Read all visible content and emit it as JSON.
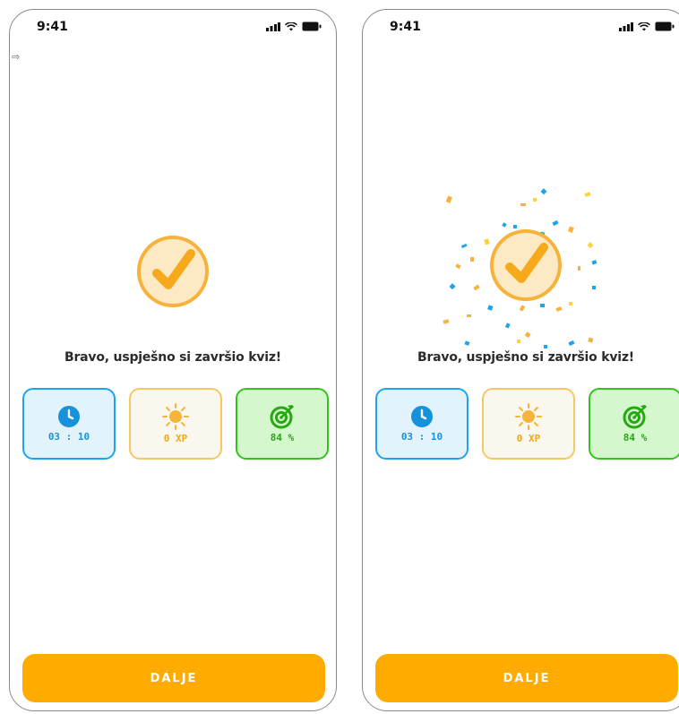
{
  "screens": [
    {
      "id": "before-confetti",
      "status_time": "9:41",
      "message": "Bravo, uspješno si završio kviz!",
      "stats": {
        "time": {
          "icon": "clock-icon",
          "value": "03 : 10"
        },
        "xp": {
          "icon": "sun-icon",
          "value": "0 XP"
        },
        "accuracy": {
          "icon": "target-icon",
          "value": "84 %"
        }
      },
      "button_label": "DALJE"
    },
    {
      "id": "with-confetti",
      "status_time": "9:41",
      "message": "Bravo, uspješno si završio kviz!",
      "stats": {
        "time": {
          "icon": "clock-icon",
          "value": "03 : 10"
        },
        "xp": {
          "icon": "sun-icon",
          "value": "0 XP"
        },
        "accuracy": {
          "icon": "target-icon",
          "value": "84 %"
        }
      },
      "button_label": "DALJE"
    }
  ],
  "colors": {
    "accent_orange": "#ffab00",
    "check_circle_fill": "#fde9c4",
    "check_circle_stroke": "#f6b23a",
    "time_blue": "#1da4ee",
    "xp_yellow": "#f6c865",
    "accuracy_green": "#35c21f",
    "confetti": [
      "#1da4ee",
      "#f6b23a",
      "#ffd23a"
    ]
  }
}
